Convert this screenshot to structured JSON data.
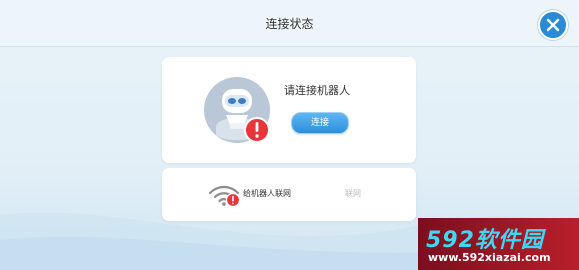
{
  "header": {
    "title": "连接状态"
  },
  "icons": {
    "close": "close-icon",
    "robot": "robot-icon",
    "warning": "warning-icon",
    "wifi": "wifi-icon"
  },
  "robot_card": {
    "label": "请连接机器人",
    "connect_label": "连接"
  },
  "network_card": {
    "label": "给机器人联网",
    "action_label": "联网"
  },
  "watermark": {
    "brand": "592软件园",
    "url": "www.592xiazai.com"
  },
  "colors": {
    "accent": "#2a8ad6",
    "warning": "#e8353a",
    "watermark_bg": "#b81f2b",
    "watermark_text": "#3fd7f5"
  }
}
